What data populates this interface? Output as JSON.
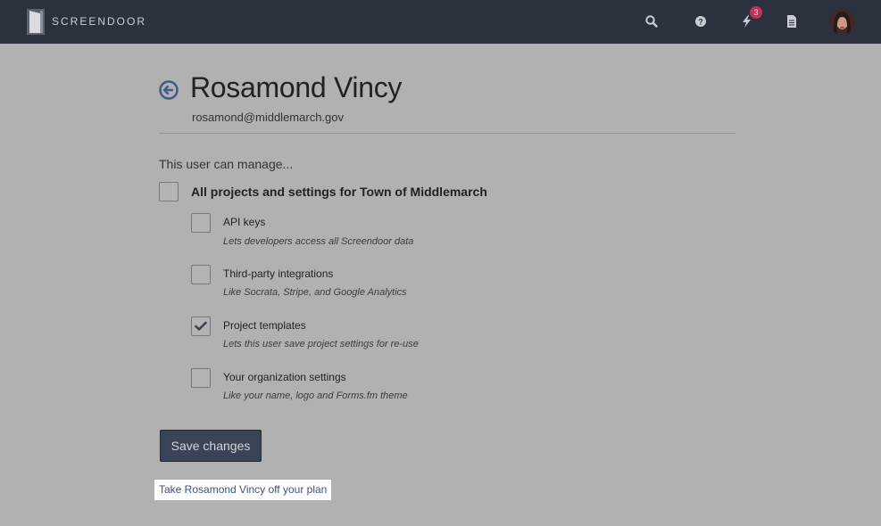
{
  "app": {
    "brand": "SCREENDOOR",
    "notification_count": "3"
  },
  "nav": {
    "icons": [
      "search-icon",
      "help-icon",
      "lightning-icon",
      "document-icon",
      "avatar"
    ]
  },
  "user": {
    "name": "Rosamond Vincy",
    "email": "rosamond@middlemarch.gov"
  },
  "permissions": {
    "intro": "This user can manage...",
    "all": {
      "label": "All projects and settings for Town of Middlemarch",
      "checked": false
    },
    "items": [
      {
        "title": "API keys",
        "description": "Lets developers access all Screendoor data",
        "checked": false
      },
      {
        "title": "Third-party integrations",
        "description": "Like Socrata, Stripe, and Google Analytics",
        "checked": false
      },
      {
        "title": "Project templates",
        "description": "Lets this user save project settings for re-use",
        "checked": true
      },
      {
        "title": "Your organization settings",
        "description": "Like your name, logo and Forms.fm theme",
        "checked": false
      }
    ]
  },
  "actions": {
    "save_label": "Save changes",
    "remove_label": "Take Rosamond Vincy off your plan"
  },
  "colors": {
    "topbar": "#2c323d",
    "background": "#b1b1b1",
    "primary_button": "#394458",
    "link": "#3b5283",
    "badge": "#c2305e"
  }
}
